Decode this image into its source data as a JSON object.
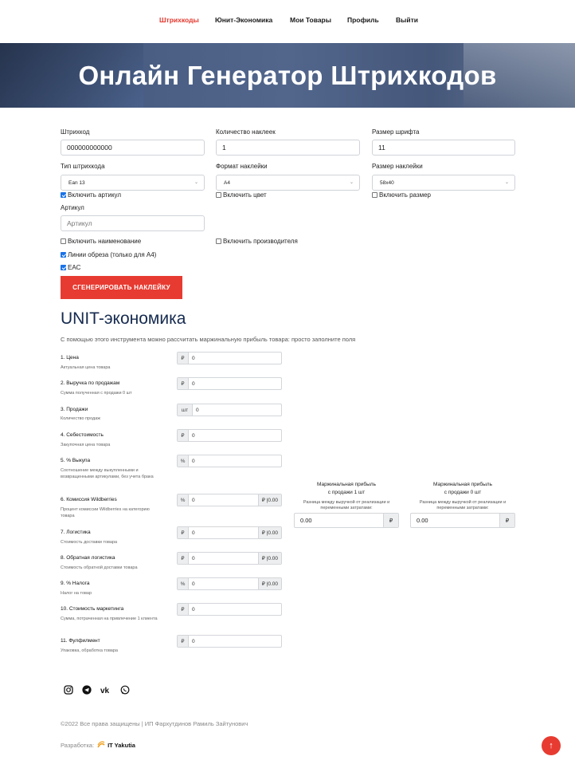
{
  "nav": {
    "items": [
      {
        "label": "Штрихкоды",
        "active": true
      },
      {
        "label": "Юнит-Экономика",
        "active": false
      },
      {
        "label": "Мои Товары",
        "active": false
      },
      {
        "label": "Профиль",
        "active": false
      },
      {
        "label": "Выйти",
        "active": false
      }
    ]
  },
  "hero": {
    "title": "Онлайн Генератор Штрихкодов"
  },
  "form": {
    "barcode": {
      "label": "Штрихкод",
      "value": "000000000000"
    },
    "sticker_count": {
      "label": "Количество наклеек",
      "value": "1"
    },
    "font_size": {
      "label": "Размер шрифта",
      "value": "11"
    },
    "barcode_type": {
      "label": "Тип штрихкода",
      "selected": "Ean 13"
    },
    "sticker_format": {
      "label": "Формат наклейки",
      "selected": "A4"
    },
    "sticker_size": {
      "label": "Размер наклейки",
      "selected": "58x40"
    },
    "include_article": {
      "label": "Включить артикул",
      "checked": true
    },
    "include_color": {
      "label": "Включить цвет",
      "checked": false
    },
    "include_size": {
      "label": "Включить размер",
      "checked": false
    },
    "article": {
      "label": "Артикул",
      "placeholder": "Артикул"
    },
    "include_name": {
      "label": "Включить наименование",
      "checked": false
    },
    "include_manufacturer": {
      "label": "Включить производителя",
      "checked": false
    },
    "cut_lines": {
      "label": "Линии обреза (только для А4)",
      "checked": true
    },
    "eac": {
      "label": "EAC",
      "checked": true
    },
    "generate_button": "СГЕНЕРИРОВАТЬ НАКЛЕЙКУ"
  },
  "unit": {
    "title": "UNIT-экономика",
    "subtitle": "С помощью этого инструмента можно рассчитать маржинальную прибыль товара: просто заполните поля",
    "fields": [
      {
        "label": "1. Цена",
        "help": "Актуальная цена товара",
        "prefix": "₽",
        "value": "0",
        "suffix": ""
      },
      {
        "label": "2. Выручка по продажам",
        "help": "Сумма полученная с продажи 0 шт",
        "prefix": "₽",
        "value": "0",
        "suffix": ""
      },
      {
        "label": "3. Продажи",
        "help": "Количество продаж",
        "prefix": "шт",
        "value": "0",
        "suffix": ""
      },
      {
        "label": "4. Себестоимость",
        "help": "Закупочная цена товара",
        "prefix": "₽",
        "value": "0",
        "suffix": ""
      },
      {
        "label": "5. % Выкупа",
        "help": "Соотношение между выкупленными и возвращенными артикулами, без учета брака",
        "prefix": "%",
        "value": "0",
        "suffix": ""
      },
      {
        "label": "6. Комиссия Wildberries",
        "help": "Процент комиссии Wildberries на категорию товара",
        "prefix": "%",
        "value": "0",
        "suffix": "₽ |0.00"
      },
      {
        "label": "7. Логистика",
        "help": "Стоимость доставки товара",
        "prefix": "₽",
        "value": "0",
        "suffix": "₽ |0.00"
      },
      {
        "label": "8. Обратная логистика",
        "help": "Стоимость обратной доставки товара",
        "prefix": "₽",
        "value": "0",
        "suffix": "₽ |0.00"
      },
      {
        "label": "9. % Налога",
        "help": "Налог на товар",
        "prefix": "%",
        "value": "0",
        "suffix": "₽ |0.00"
      },
      {
        "label": "10. Стоимость маркетинга",
        "help": "Сумма, потраченная на привлечение 1 клиента",
        "prefix": "₽",
        "value": "0",
        "suffix": ""
      },
      {
        "label": "11. Фулфилмент",
        "help": "Упаковка, обработка товара",
        "prefix": "₽",
        "value": "0",
        "suffix": ""
      }
    ],
    "margin_one": {
      "title_line1": "Маржинальная прибыль",
      "title_line2": "с продажи 1 шт",
      "help": "Разница между выручкой от реализации и переменными затратами:",
      "value": "0.00",
      "currency": "₽"
    },
    "margin_all": {
      "title_line1": "Маржинальная прибыль",
      "title_line2": "с продажи 0 шт",
      "help": "Разница между выручкой от реализации и переменными затратами:",
      "value": "0.00",
      "currency": "₽"
    }
  },
  "footer": {
    "social_icons": [
      "instagram-icon",
      "telegram-icon",
      "vk-icon",
      "whatsapp-icon"
    ],
    "copyright": "©2022 Все права защищены | ИП Фархутдинов Рамиль Зайтунович",
    "dev_label": "Разработка:",
    "dev_brand": "IT Yakutia"
  },
  "colors": {
    "accent": "#e73b31",
    "title": "#152a4f",
    "check": "#1a73e8"
  }
}
